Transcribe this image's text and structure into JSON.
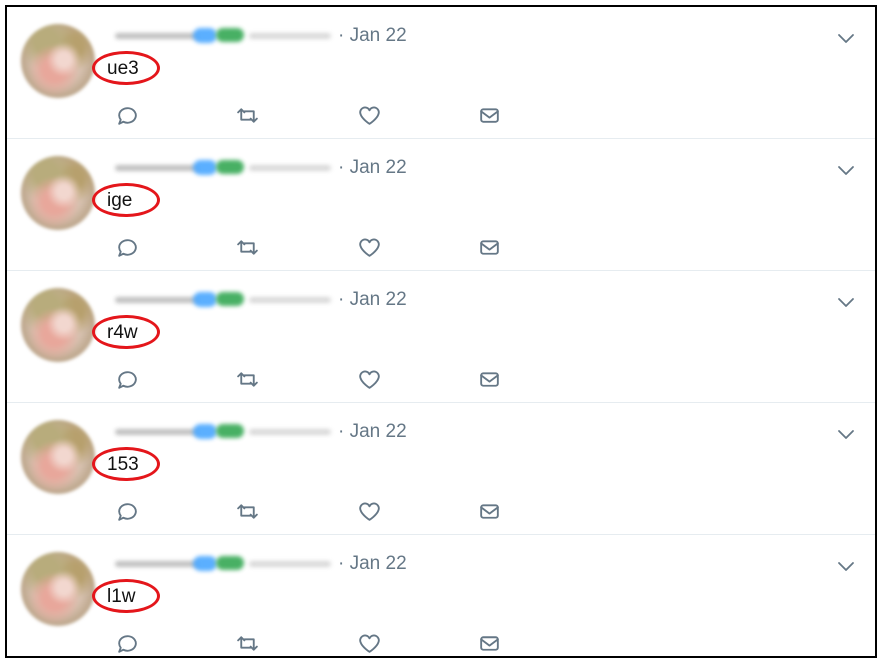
{
  "tweets": [
    {
      "date": "· Jan 22",
      "content": "ue3"
    },
    {
      "date": "· Jan 22",
      "content": "ige"
    },
    {
      "date": "· Jan 22",
      "content": "r4w"
    },
    {
      "date": "· Jan 22",
      "content": "153"
    },
    {
      "date": "· Jan 22",
      "content": "l1w"
    }
  ],
  "colors": {
    "meta": "#657786",
    "highlight": "#e4161b",
    "divider": "#e6ecf0"
  },
  "icons": {
    "menu": "chevron-down-icon",
    "reply": "reply-icon",
    "retweet": "retweet-icon",
    "like": "heart-icon",
    "message": "mail-icon"
  }
}
